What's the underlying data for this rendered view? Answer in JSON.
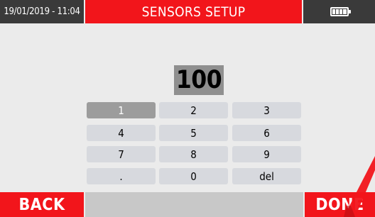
{
  "header": {
    "datetime": "19/01/2019 - 11:04",
    "title": "SENSORS SETUP",
    "battery_icon": "battery-full-icon"
  },
  "value_display": {
    "value": "100"
  },
  "keypad": {
    "selected_key": "1",
    "keys": [
      "1",
      "2",
      "3",
      "4",
      "5",
      "6",
      "7",
      "8",
      "9",
      ".",
      "0",
      "del"
    ]
  },
  "footer": {
    "back_label": "BACK",
    "done_label": "DONE"
  },
  "colors": {
    "accent_red": "#f2151b",
    "dark_bar": "#3a3a3a",
    "key_bg": "#d7d9de",
    "key_selected_bg": "#9c9c9c",
    "value_bg": "#8f8f8f",
    "screen_bg": "#ebebeb"
  }
}
